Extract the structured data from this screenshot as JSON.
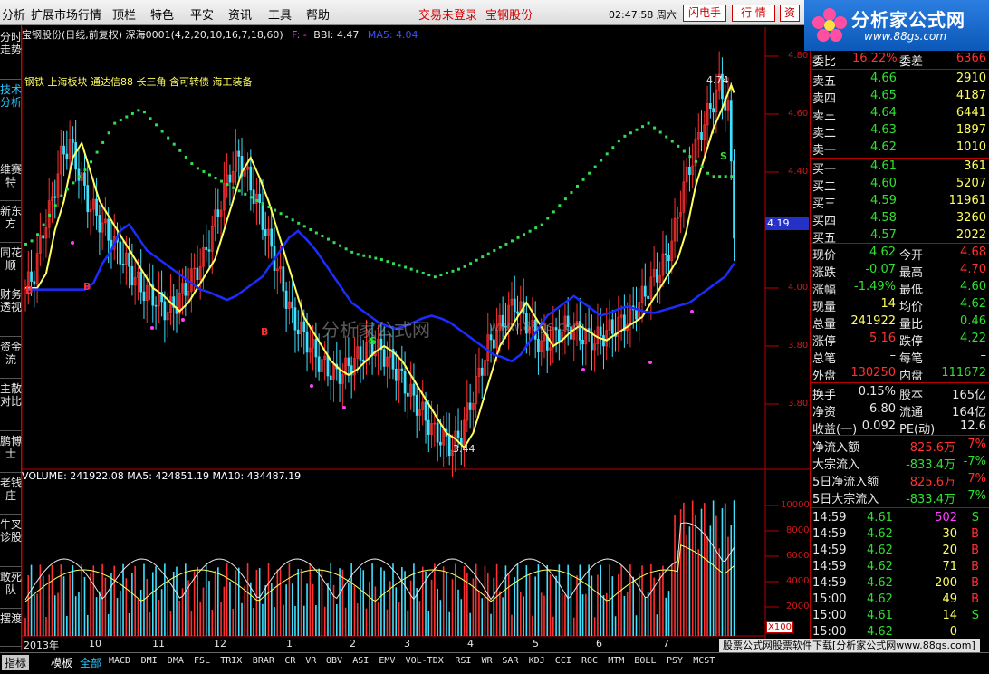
{
  "menu": {
    "items": [
      "分析",
      "扩展市场行情",
      "顶栏",
      "特色",
      "平安",
      "资讯",
      "工具",
      "帮助"
    ],
    "trade_status": "交易未登录",
    "stock_name": "宝钢股份",
    "clock": "02:47:58 周六",
    "btn_flash": "闪电手",
    "btn_quote": "行  情",
    "btn_info": "资"
  },
  "logo": {
    "title": "分析家公式网",
    "url": "www.88gs.com"
  },
  "left_tabs": [
    "分时走势",
    "技术分析",
    "维赛特",
    "新东方",
    "同花顺",
    "财务透视",
    "资金流",
    "主散对比",
    "鹏博士",
    "老钱庄",
    "牛叉诊股",
    "敢死队",
    "摆渡"
  ],
  "chart": {
    "header_prefix": "宝钢股份(日线,前复权) 深海0001(4,2,20,10,16,7,18,60)",
    "header_f": "F: -",
    "header_bbi": "BBI: 4.47",
    "header_ma5": "MA5: 4.04",
    "blocks_text": "钢铁 上海板块 通达信88 长三角 含可转债 海工装备",
    "high_marker": "4.74",
    "low_marker": "3.44",
    "current_price_tag": "4.19",
    "price_axis": [
      "4.80",
      "4.60",
      "4.40",
      "4.00",
      "3.80",
      "3.80"
    ],
    "volume_header": "VOLUME: 241922.08 MA5: 424851.19 MA10: 434487.19",
    "volume_axis": [
      "10000",
      "8000",
      "6000",
      "4000",
      "2000"
    ],
    "x_labels": [
      "2013年",
      "10",
      "11",
      "12",
      "1",
      "2",
      "3",
      "4",
      "5",
      "6",
      "7"
    ],
    "x100": "X100",
    "watermark": "分析家公式网",
    "watermark_url": "www.88gs.com",
    "marker_b": "B",
    "marker_s": "S",
    "colors": {
      "up": "#ff3030",
      "down": "#40e0ff",
      "ma_yellow": "#ffff60",
      "ma_blue": "#1c2cff",
      "dots": "#30e050"
    }
  },
  "chart_data": {
    "type": "candlestick",
    "title": "宝钢股份(日线,前复权)",
    "x_axis_ticks": [
      "2013年",
      "10",
      "11",
      "12",
      "1",
      "2",
      "3",
      "4",
      "5",
      "6",
      "7"
    ],
    "price_range": [
      3.4,
      4.8
    ],
    "high": 4.74,
    "low": 3.44,
    "series": [
      {
        "name": "MA5",
        "value": 4.04
      },
      {
        "name": "BBI",
        "value": 4.47
      }
    ],
    "volume": {
      "VOLUME": 241922.08,
      "MA5": 424851.19,
      "MA10": 434487.19
    }
  },
  "quote": {
    "weibi_label": "委比",
    "weibi": "16.22%",
    "weicha_label": "委差",
    "weicha": "6366",
    "asks": [
      {
        "label": "卖五",
        "price": "4.66",
        "vol": "2910"
      },
      {
        "label": "卖四",
        "price": "4.65",
        "vol": "4187"
      },
      {
        "label": "卖三",
        "price": "4.64",
        "vol": "6441"
      },
      {
        "label": "卖二",
        "price": "4.63",
        "vol": "1897"
      },
      {
        "label": "卖一",
        "price": "4.62",
        "vol": "1010"
      }
    ],
    "bids": [
      {
        "label": "买一",
        "price": "4.61",
        "vol": "361"
      },
      {
        "label": "买二",
        "price": "4.60",
        "vol": "5207"
      },
      {
        "label": "买三",
        "price": "4.59",
        "vol": "11961"
      },
      {
        "label": "买四",
        "price": "4.58",
        "vol": "3260"
      },
      {
        "label": "买五",
        "price": "4.57",
        "vol": "2022"
      }
    ],
    "stats": [
      {
        "l1": "现价",
        "v1": "4.62",
        "c1": "#30e030",
        "l2": "今开",
        "v2": "4.68",
        "c2": "#ff3030"
      },
      {
        "l1": "涨跌",
        "v1": "-0.07",
        "c1": "#30e030",
        "l2": "最高",
        "v2": "4.70",
        "c2": "#ff3030"
      },
      {
        "l1": "涨幅",
        "v1": "-1.49%",
        "c1": "#30e030",
        "l2": "最低",
        "v2": "4.60",
        "c2": "#30e030"
      },
      {
        "l1": "现量",
        "v1": "14",
        "c1": "#ffff60",
        "l2": "均价",
        "v2": "4.62",
        "c2": "#30e030"
      },
      {
        "l1": "总量",
        "v1": "241922",
        "c1": "#ffff60",
        "l2": "量比",
        "v2": "0.46",
        "c2": "#30e030"
      },
      {
        "l1": "涨停",
        "v1": "5.16",
        "c1": "#ff3030",
        "l2": "跌停",
        "v2": "4.22",
        "c2": "#30e030"
      },
      {
        "l1": "总笔",
        "v1": "–",
        "c1": "#e8e8e8",
        "l2": "每笔",
        "v2": "–",
        "c2": "#e8e8e8"
      },
      {
        "l1": "外盘",
        "v1": "130250",
        "c1": "#ff3030",
        "l2": "内盘",
        "v2": "111672",
        "c2": "#30e030"
      }
    ],
    "stats2": [
      {
        "l1": "换手",
        "v1": "0.15%",
        "c1": "#e8e8e8",
        "l2": "股本",
        "v2": "165亿",
        "c2": "#e8e8e8"
      },
      {
        "l1": "净资",
        "v1": "6.80",
        "c1": "#e8e8e8",
        "l2": "流通",
        "v2": "164亿",
        "c2": "#e8e8e8"
      },
      {
        "l1": "收益(一)",
        "v1": "0.092",
        "c1": "#e8e8e8",
        "l2": "PE(动)",
        "v2": "12.6",
        "c2": "#e8e8e8"
      }
    ],
    "flows": [
      {
        "label": "净流入额",
        "val": "825.6万",
        "pct": "7%",
        "c": "#ff3030"
      },
      {
        "label": "大宗流入",
        "val": "-833.4万",
        "pct": "-7%",
        "c": "#30e030"
      },
      {
        "label": "5日净流入额",
        "val": "825.6万",
        "pct": "7%",
        "c": "#ff3030"
      },
      {
        "label": "5日大宗流入",
        "val": "-833.4万",
        "pct": "-7%",
        "c": "#30e030"
      }
    ],
    "ticks": [
      {
        "t": "14:59",
        "p": "4.61",
        "pc": "#30e030",
        "v": "502",
        "vc": "#ff40ff",
        "s": "S",
        "sc": "#30e030"
      },
      {
        "t": "14:59",
        "p": "4.62",
        "pc": "#30e030",
        "v": "30",
        "vc": "#ffff60",
        "s": "B",
        "sc": "#ff3030"
      },
      {
        "t": "14:59",
        "p": "4.62",
        "pc": "#30e030",
        "v": "20",
        "vc": "#ffff60",
        "s": "B",
        "sc": "#ff3030"
      },
      {
        "t": "14:59",
        "p": "4.62",
        "pc": "#30e030",
        "v": "71",
        "vc": "#ffff60",
        "s": "B",
        "sc": "#ff3030"
      },
      {
        "t": "14:59",
        "p": "4.62",
        "pc": "#30e030",
        "v": "200",
        "vc": "#ffff60",
        "s": "B",
        "sc": "#ff3030"
      },
      {
        "t": "15:00",
        "p": "4.62",
        "pc": "#30e030",
        "v": "49",
        "vc": "#ffff60",
        "s": "B",
        "sc": "#ff3030"
      },
      {
        "t": "15:00",
        "p": "4.61",
        "pc": "#30e030",
        "v": "14",
        "vc": "#ffff60",
        "s": "S",
        "sc": "#30e030"
      },
      {
        "t": "15:00",
        "p": "4.62",
        "pc": "#30e030",
        "v": "0",
        "vc": "#ffff60",
        "s": "",
        "sc": "#30e030"
      }
    ]
  },
  "bottom": {
    "tab_indicator": "指标",
    "tab_template": "模板",
    "tab_all": "全部",
    "indicators": [
      "MACD",
      "DMI",
      "DMA",
      "FSL",
      "TRIX",
      "BRAR",
      "CR",
      "VR",
      "OBV",
      "ASI",
      "EMV",
      "VOL-TDX",
      "RSI",
      "WR",
      "SAR",
      "KDJ",
      "CCI",
      "ROC",
      "MTM",
      "BOLL",
      "PSY",
      "MCST"
    ],
    "footer_banner": "股票公式网股票软件下载[分析家公式网www.88gs.com]"
  }
}
